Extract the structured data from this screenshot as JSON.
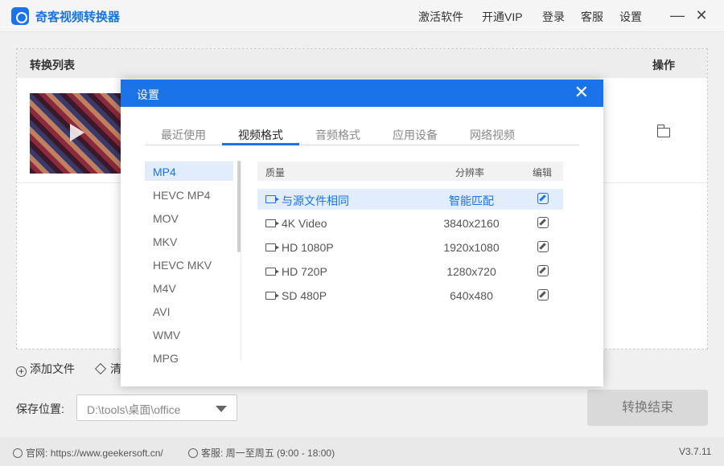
{
  "app": {
    "title": "奇客视频转换器",
    "menu": [
      "激活软件",
      "开通VIP",
      "登录",
      "客服",
      "设置"
    ],
    "window_buttons": [
      "—",
      "✕"
    ]
  },
  "list": {
    "col_title": "转换列表",
    "col_action": "操作"
  },
  "toolbar": {
    "add_file": "添加文件",
    "clear_partial": "清"
  },
  "save": {
    "label": "保存位置:",
    "path": "D:\\tools\\桌面\\office"
  },
  "convert_button": "转换结束",
  "status": {
    "website_label": "官网:",
    "website": "https://www.geekersoft.cn/",
    "service_label": "客服:",
    "service_hours": "周一至周五 (9:00 - 18:00)",
    "version": "V3.7.11"
  },
  "dialog": {
    "title": "设置",
    "close": "✕",
    "tabs": [
      "最近使用",
      "视频格式",
      "音频格式",
      "应用设备",
      "网络视频"
    ],
    "active_tab": "视频格式",
    "formats": [
      "MP4",
      "HEVC MP4",
      "MOV",
      "MKV",
      "HEVC MKV",
      "M4V",
      "AVI",
      "WMV",
      "MPG"
    ],
    "selected_format": "MP4",
    "quality_header": {
      "quality": "质量",
      "resolution": "分辨率",
      "edit": "编辑"
    },
    "qualities": [
      {
        "name": "与源文件相同",
        "resolution": "智能匹配"
      },
      {
        "name": "4K Video",
        "resolution": "3840x2160"
      },
      {
        "name": "HD 1080P",
        "resolution": "1920x1080"
      },
      {
        "name": "HD 720P",
        "resolution": "1280x720"
      },
      {
        "name": "SD 480P",
        "resolution": "640x480"
      }
    ]
  },
  "colors": {
    "accent": "#1a73e8",
    "selected_bg": "#e1edfc"
  }
}
